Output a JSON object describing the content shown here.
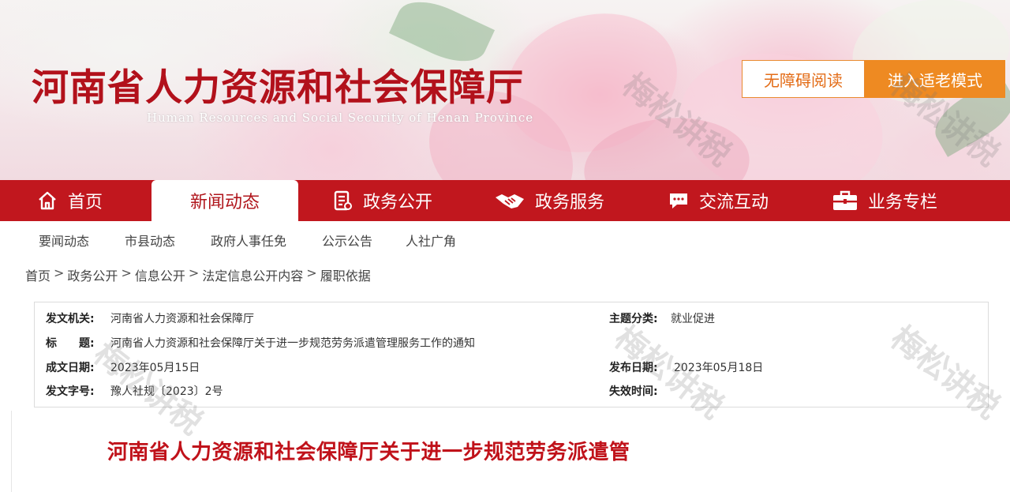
{
  "header": {
    "title": "河南省人力资源和社会保障厅",
    "subtitle": "Human Resources and Social Security of Henan Province",
    "accessibility_label": "无障碍阅读",
    "elderly_mode_label": "进入适老模式"
  },
  "nav": {
    "items": [
      {
        "label": "首页",
        "icon": "home-icon"
      },
      {
        "label": "新闻动态",
        "icon": ""
      },
      {
        "label": "政务公开",
        "icon": "document-icon"
      },
      {
        "label": "政务服务",
        "icon": "handshake-icon"
      },
      {
        "label": "交流互动",
        "icon": "chat-icon"
      },
      {
        "label": "业务专栏",
        "icon": "briefcase-icon"
      }
    ],
    "active_index": 1,
    "colors": {
      "bar": "#c1171e",
      "active_text": "#b0161c"
    }
  },
  "subnav": {
    "items": [
      "要闻动态",
      "市县动态",
      "政府人事任免",
      "公示公告",
      "人社广角"
    ]
  },
  "breadcrumb": [
    "首页",
    "政务公开",
    "信息公开",
    "法定信息公开内容",
    "履职依据"
  ],
  "breadcrumb_separator": ">",
  "info": {
    "issuer_label": "发文机关:",
    "issuer_value": "河南省人力资源和社会保障厅",
    "topic_label": "主题分类:",
    "topic_value": "就业促进",
    "title_label": "标　　题:",
    "title_value": "河南省人力资源和社会保障厅关于进一步规范劳务派遣管理服务工作的通知",
    "created_label": "成文日期:",
    "created_value": "2023年05月15日",
    "published_label": "发布日期:",
    "published_value": "2023年05月18日",
    "docno_label": "发文字号:",
    "docno_value": "豫人社规〔2023〕2号",
    "expiry_label": "失效时间:",
    "expiry_value": ""
  },
  "article": {
    "title": "河南省人力资源和社会保障厅关于进一步规范劳务派遣管"
  },
  "watermark": {
    "text": "梅松讲税"
  }
}
